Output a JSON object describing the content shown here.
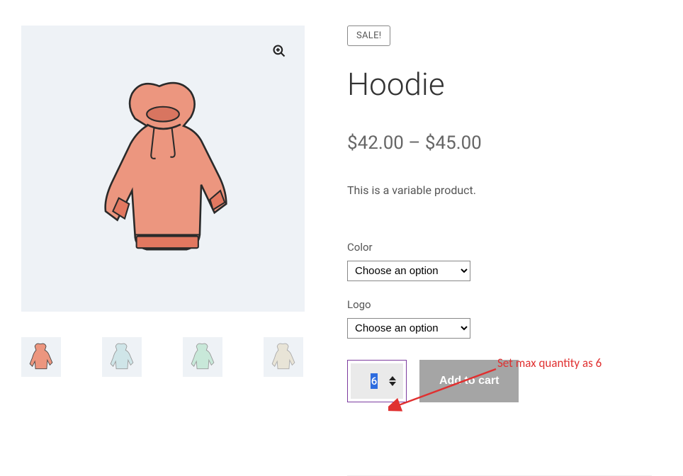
{
  "badge": "SALE!",
  "title": "Hoodie",
  "price": "$42.00 – $45.00",
  "description": "This is a variable product.",
  "variations": {
    "color": {
      "label": "Color",
      "selected": "Choose an option"
    },
    "logo": {
      "label": "Logo",
      "selected": "Choose an option"
    }
  },
  "quantity": {
    "value": "6"
  },
  "add_to_cart_label": "Add to cart",
  "annotation_text": "Set max quantity as 6",
  "thumbnails": [
    {
      "color": "#e98c7a"
    },
    {
      "color": "#cfe5e8"
    },
    {
      "color": "#c8e8d9"
    },
    {
      "color": "#d7e0e0"
    }
  ],
  "main_image": {
    "color": "#e98c7a"
  }
}
